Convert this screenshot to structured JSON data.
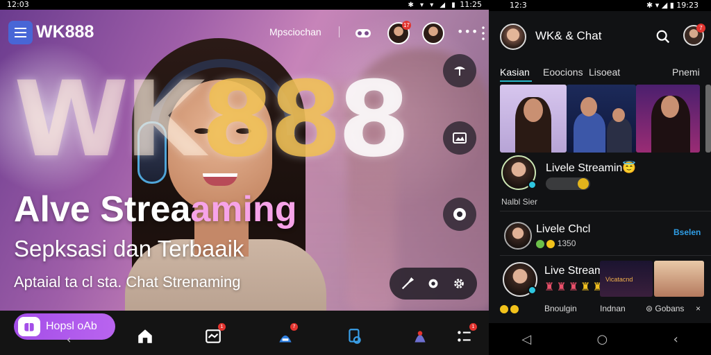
{
  "left": {
    "status_bar": {
      "time": "12:03",
      "right_time": "11:25"
    },
    "header": {
      "brand": "WK888",
      "link_text": "Mpsciochan",
      "avatar_badge": "17"
    },
    "watermark": {
      "text_a": "WK",
      "text_b": "8",
      "text_c": "8",
      "text_d": "8"
    },
    "hero": {
      "title_a": "Alve Strea",
      "title_b": "aming",
      "subtitle": "Sepksasi dan Terbaaik",
      "description": "Aptaial ta cl sta. Chat Strenaming"
    },
    "promo": {
      "label": "Hopsl oAb"
    },
    "nav_badges": {
      "inbox": "1",
      "live": "7",
      "menu": "1"
    },
    "icons": {
      "menu": "hamburger-icon",
      "gamepad": "gamepad-icon",
      "dots": "more-icon",
      "side1": "lamp-icon",
      "side2": "gallery-icon",
      "side3": "record-icon",
      "tool1": "brush-icon",
      "tool2": "effects-icon",
      "tool3": "settings-icon",
      "nav_home": "home-icon",
      "nav_inbox": "inbox-icon",
      "nav_live": "live-icon",
      "nav_files": "files-icon",
      "nav_party": "party-icon",
      "nav_more": "grid-icon"
    }
  },
  "right": {
    "status_bar": {
      "time": "12:3",
      "right_time": "19:23"
    },
    "header": {
      "title": "WK& & Chat",
      "user_badge": "7"
    },
    "tabs": [
      {
        "label": "Kasian",
        "active": true
      },
      {
        "label": "Eoocions",
        "active": false
      },
      {
        "label": "Lisoeat",
        "active": false
      },
      {
        "label": "Pnemi",
        "active": false
      }
    ],
    "rows": {
      "row1_name": "Livele Streamin",
      "row1_emoji": "😇",
      "row1_sub": "Nalbl Sier",
      "row2_name": "Livele Chcl",
      "row2_count": "1350",
      "row2_action": "Bselen",
      "row3_name": "Live Streaming",
      "row3_thumb_label": "Vicatacnd"
    },
    "footer_row": {
      "item1": "Bnoulgin",
      "item2": "Indnan",
      "item3": "Gobans",
      "close": "×"
    },
    "android_nav": {
      "back": "◁",
      "home": "○",
      "recent": "‹"
    }
  },
  "colors": {
    "accent_blue": "#4866d6",
    "teal": "#29b7c9",
    "purple": "#a44ee8",
    "badge_red": "#e2342f",
    "gold": "#f2c21b"
  }
}
